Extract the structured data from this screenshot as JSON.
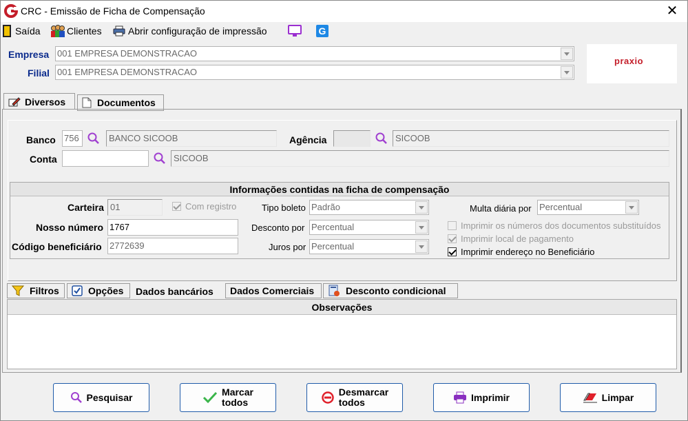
{
  "window": {
    "title": "CRC - Emissão de Ficha de Compensação",
    "close": "✕"
  },
  "toolbar": {
    "exit": "Saída",
    "clients": "Clientes",
    "print_config": "Abrir configuração de impressão"
  },
  "header": {
    "empresa_label": "Empresa",
    "empresa_value": "001 EMPRESA DEMONSTRACAO",
    "filial_label": "Filial",
    "filial_value": "001 EMPRESA DEMONSTRACAO",
    "logo": "praxio"
  },
  "top_tabs": [
    {
      "label": "Diversos"
    },
    {
      "label": "Documentos"
    }
  ],
  "bank": {
    "banco_label": "Banco",
    "banco_code": "756",
    "banco_name": "BANCO SICOOB",
    "agencia_label": "Agência",
    "agencia_name": "SICOOB",
    "conta_label": "Conta",
    "conta_name": "SICOOB"
  },
  "ficha": {
    "title": "Informações contidas na ficha de compensação",
    "carteira_label": "Carteira",
    "carteira_value": "01",
    "com_registro": "Com registro",
    "nosso_numero_label": "Nosso número",
    "nosso_numero_value": "1767",
    "codigo_benef_label": "Código beneficiário",
    "codigo_benef_value": "2772639",
    "tipo_boleto_label": "Tipo boleto",
    "tipo_boleto_value": "Padrão",
    "desconto_por_label": "Desconto por",
    "desconto_por_value": "Percentual",
    "juros_por_label": "Juros por",
    "juros_por_value": "Percentual",
    "multa_label": "Multa diária por",
    "multa_value": "Percentual",
    "chk_docs": "Imprimir os números dos documentos substituídos",
    "chk_local": "Imprimir local de pagamento",
    "chk_endereco": "Imprimir endereço no Beneficiário"
  },
  "sub_tabs": [
    {
      "label": "Filtros"
    },
    {
      "label": "Opções"
    },
    {
      "label": "Dados bancários"
    },
    {
      "label": "Dados Comerciais"
    },
    {
      "label": "Desconto condicional"
    }
  ],
  "observacoes": {
    "title": "Observações"
  },
  "buttons": {
    "pesquisar": "Pesquisar",
    "marcar_1": "Marcar",
    "marcar_2": "todos",
    "desmarcar_1": "Desmarcar",
    "desmarcar_2": "todos",
    "imprimir": "Imprimir",
    "limpar": "Limpar"
  },
  "colors": {
    "accent_blue": "#0a2a8c",
    "icon_purple": "#a040d0",
    "logo_red": "#c41e2a"
  }
}
